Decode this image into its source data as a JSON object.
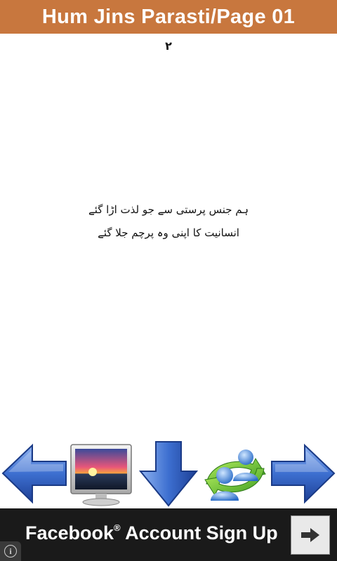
{
  "header": {
    "title": "Hum Jins Parasti/Page 01"
  },
  "content": {
    "page_number": "٢",
    "verse_lines": [
      "ہم جنس پرستی سے جو لذت اڑا گئے",
      "انسانیت کا اپنی وہ پرچم جلا گئے"
    ]
  },
  "toolbar": {
    "buttons": [
      {
        "icon": "arrow-left-icon"
      },
      {
        "icon": "monitor-sunset-icon"
      },
      {
        "icon": "arrow-down-icon"
      },
      {
        "icon": "users-share-icon"
      },
      {
        "icon": "arrow-right-icon"
      }
    ]
  },
  "ad": {
    "text": "Facebook",
    "trademark": "®",
    "text_rest": " Account Sign Up",
    "action_icon": "arrow-right-icon",
    "info_icon": "info-icon"
  },
  "colors": {
    "title_bar": "#c8773e",
    "ad_bar": "#1a1a1a",
    "arrow_blue": "#2f5fbf"
  }
}
